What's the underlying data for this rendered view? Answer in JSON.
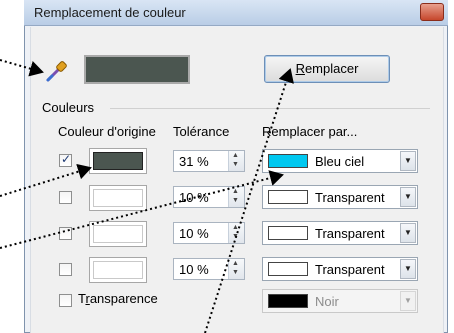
{
  "dialog": {
    "title": "Remplacement de couleur",
    "close_glyph": "✕",
    "preview_color": "#4b5650"
  },
  "toolbar": {
    "replace_label_ul": "R",
    "replace_label_rest": "emplacer"
  },
  "group": {
    "label": "Couleurs",
    "col_source": "Couleur d'origine",
    "col_tolerance": "Tolérance",
    "col_replace": "Remplacer par..."
  },
  "rows": [
    {
      "checked": true,
      "source_color": "#4b5650",
      "tolerance": "31 %",
      "replace_color": "#00c8f0",
      "replace_label": "Bleu ciel"
    },
    {
      "checked": false,
      "source_color": "",
      "tolerance": "10 %",
      "replace_color": "#ffffff",
      "replace_label": "Transparent"
    },
    {
      "checked": false,
      "source_color": "",
      "tolerance": "10 %",
      "replace_color": "#ffffff",
      "replace_label": "Transparent"
    },
    {
      "checked": false,
      "source_color": "",
      "tolerance": "10 %",
      "replace_color": "#ffffff",
      "replace_label": "Transparent"
    }
  ],
  "transparency": {
    "label_pre": "T",
    "label_ul": "r",
    "label_rest": "ansparence",
    "color": "#000000",
    "color_label": "Noir"
  },
  "icons": {
    "pipette": "pipette-icon",
    "spin_up": "▲",
    "spin_down": "▼",
    "dropdown": "▼"
  }
}
